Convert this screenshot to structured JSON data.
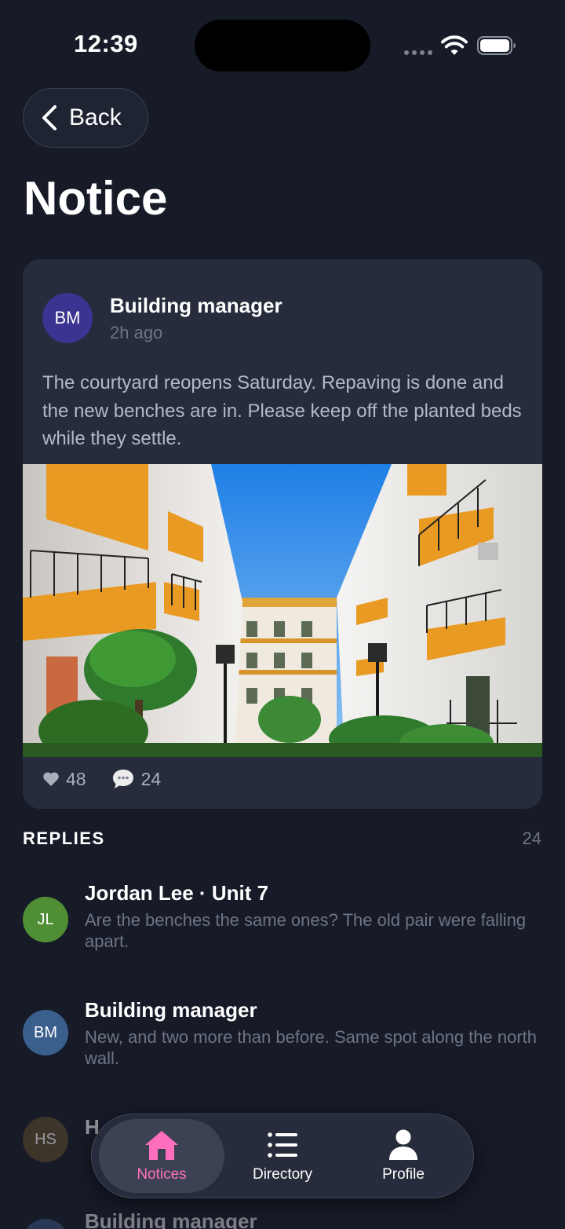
{
  "status_bar": {
    "time": "12:39"
  },
  "header": {
    "back_label": "Back",
    "title": "Notice"
  },
  "notice": {
    "avatar_initials": "BM",
    "author": "Building manager",
    "time": "2h ago",
    "body": "The courtyard reopens Saturday. Repaving is done and the new benches are in. Please keep off the planted beds while they settle.",
    "likes": "48",
    "comments": "24"
  },
  "replies": {
    "heading": "REPLIES",
    "count": "24",
    "items": [
      {
        "initials": "JL",
        "author": "Jordan Lee · Unit 7",
        "text": "Are the benches the same ones? The old pair were falling apart.",
        "color": "#4f8e34"
      },
      {
        "initials": "BM",
        "author": "Building manager",
        "text": "New, and two more than before. Same spot along the north wall.",
        "color": "#3b5f8c"
      },
      {
        "initials": "HS",
        "author": "H",
        "text": "",
        "color": "#5d4a2c"
      },
      {
        "initials": "",
        "author": "Building manager",
        "text": "",
        "color": "#3b5f8c"
      }
    ]
  },
  "tabs": [
    {
      "label": "Notices",
      "icon": "home-icon",
      "active": true
    },
    {
      "label": "Directory",
      "icon": "list-icon",
      "active": false
    },
    {
      "label": "Profile",
      "icon": "person-icon",
      "active": false
    }
  ],
  "colors": {
    "accent": "#ff6fbe",
    "background": "#171b28",
    "card": "#262c3c"
  }
}
